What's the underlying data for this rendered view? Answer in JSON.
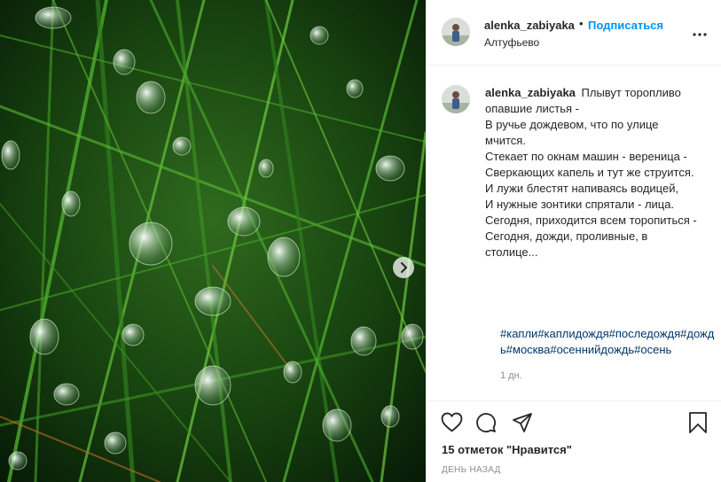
{
  "post": {
    "author": {
      "username": "alenka_zabiyaka",
      "location": "Алтуфьево"
    },
    "follow_label": "Подписаться",
    "separator": "•",
    "caption_lines": [
      "Плывут торопливо опавшие листья -",
      "В ручье дождевом, что по улице мчится.",
      "Стекает по окнам машин - вереница -",
      "Сверкающих капель и тут же струится.",
      "И лужи блестят напиваясь водицей,",
      "И нужные зонтики спрятали - лица.",
      "Сегодня, приходится всем торопиться -",
      "Сегодня, дожди, проливные, в столице..."
    ],
    "hashtags": "#капли#каплидождя#последождя#дождь#москва#осеннийдождь#осень",
    "time_ago": "1 дн.",
    "likes": "15 отметок \"Нравится\"",
    "date_label": "ДЕНЬ НАЗАД"
  },
  "icons": {
    "like": "heart-icon",
    "comment": "comment-icon",
    "share": "share-icon",
    "save": "bookmark-icon",
    "more": "more-icon",
    "next": "chevron-right-icon"
  },
  "colors": {
    "link": "#0095f6",
    "hashtag": "#00376b",
    "muted": "#8e8e8e",
    "text": "#262626"
  }
}
